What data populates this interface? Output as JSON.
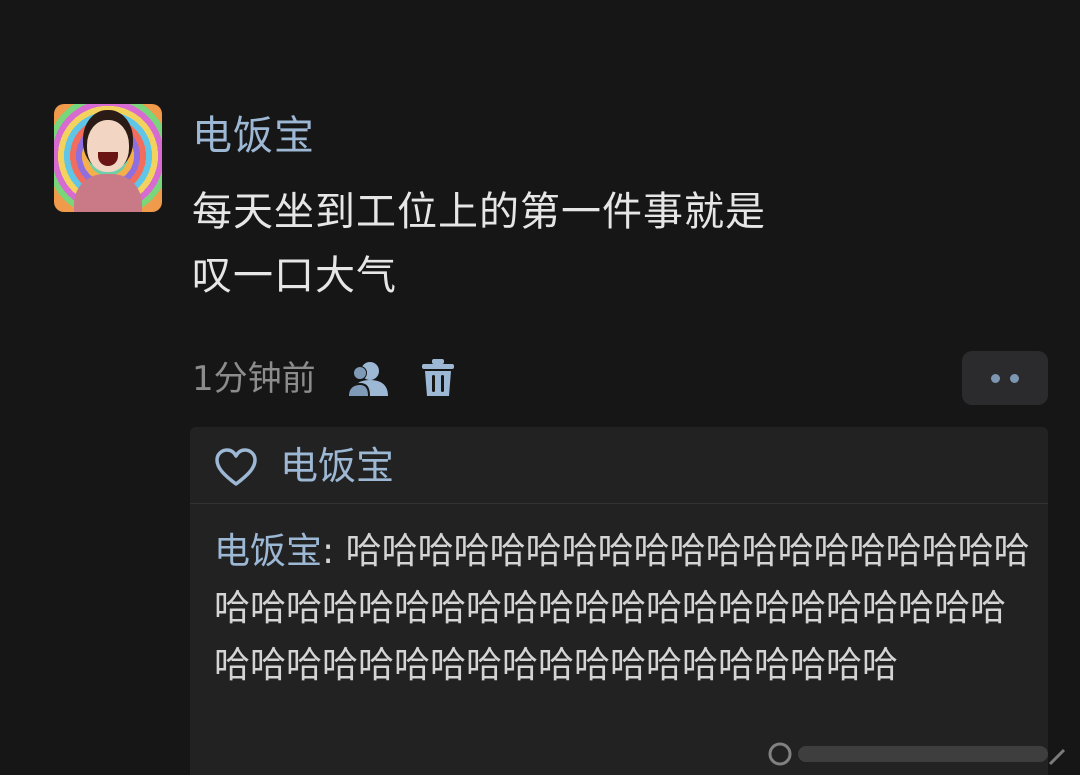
{
  "post": {
    "author": "电饭宝",
    "text_line1": "每天坐到工位上的第一件事就是",
    "text_line2": "叹一口大气",
    "time": "1分钟前",
    "icons": {
      "visibility": "user-icon",
      "delete": "trash-icon",
      "more": "more-dots-icon"
    }
  },
  "likes": {
    "icon": "heart-icon",
    "names": "电饭宝"
  },
  "reply": {
    "author": "电饭宝",
    "separator": ": ",
    "text": "哈哈哈哈哈哈哈哈哈哈哈哈哈哈哈哈哈哈哈哈哈哈哈哈哈哈哈哈哈哈哈哈哈哈哈哈哈哈哈哈哈哈哈哈哈哈哈哈哈哈哈哈哈哈哈哈哈哈哈哈"
  },
  "colors": {
    "background": "#161616",
    "name_blue": "#9cb8d4",
    "panel": "#222222"
  }
}
